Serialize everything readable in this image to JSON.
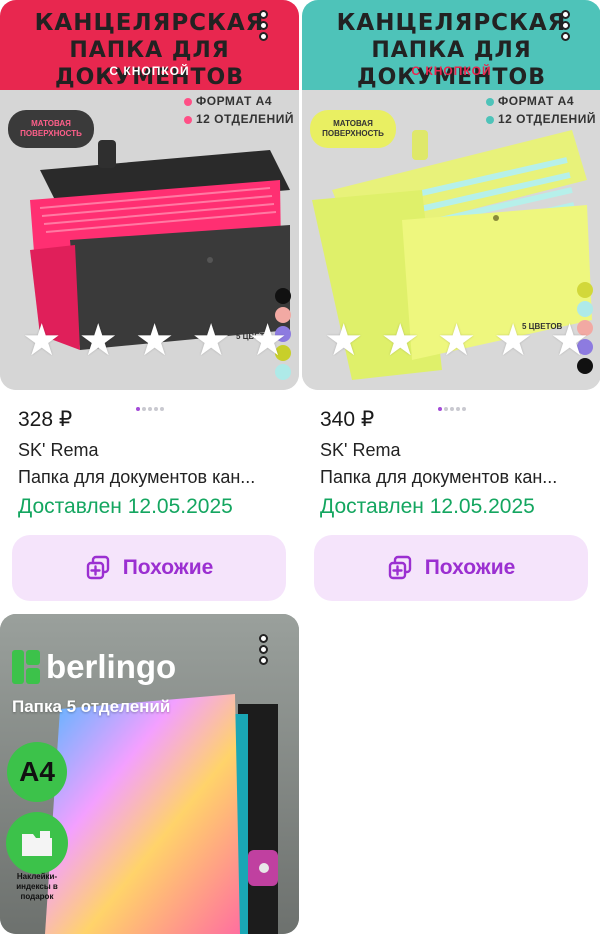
{
  "products": [
    {
      "banner": {
        "title_line1": "КАНЦЕЛЯРСКАЯ",
        "title_line2": "ПАПКА ДЛЯ ДОКУМЕНТОВ",
        "subtitle": "С КНОПКОЙ",
        "badge": "МАТОВАЯ ПОВЕРХНОСТЬ",
        "feature1": "ФОРМАТ А4",
        "feature2": "12 ОТДЕЛЕНИЙ",
        "colors_count": "5 ЦВЕТ",
        "bg_color": "#e8274f"
      },
      "rating_stars": 5,
      "price": "328 ₽",
      "seller": "SK' Rema",
      "name": "Папка для документов кан...",
      "delivery": "Доставлен 12.05.2025",
      "similar_label": "Похожие"
    },
    {
      "banner": {
        "title_line1": "КАНЦЕЛЯРСКАЯ",
        "title_line2": "ПАПКА ДЛЯ ДОКУМЕНТОВ",
        "subtitle": "С КНОПКОЙ",
        "badge": "МАТОВАЯ ПОВЕРХНОСТЬ",
        "feature1": "ФОРМАТ А4",
        "feature2": "12 ОТДЕЛЕНИЙ",
        "colors_count": "5 ЦВЕТОВ",
        "bg_color": "#4ec3b9"
      },
      "rating_stars": 5,
      "price": "340 ₽",
      "seller": "SK' Rema",
      "name": "Папка для документов кан...",
      "delivery": "Доставлен 12.05.2025",
      "similar_label": "Похожие"
    },
    {
      "brand_logo": "berlingo",
      "subtitle": "Папка 5 отделений",
      "format_badge": "А4",
      "sticker_text": "Наклейки-индексы в подарок"
    }
  ],
  "colors": {
    "accent": "#9b2fd1",
    "delivery_green": "#14a660",
    "button_bg": "#f5e4fb",
    "berlingo_green": "#3cc24a"
  }
}
